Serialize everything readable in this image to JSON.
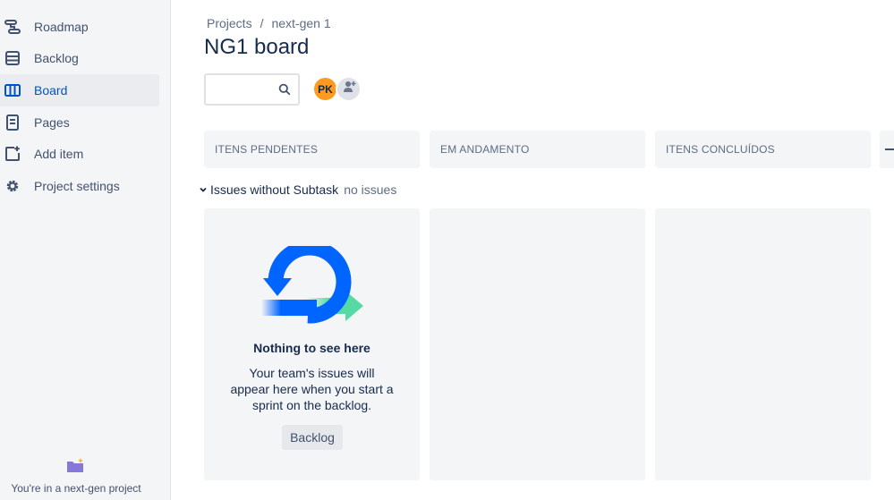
{
  "sidebar": {
    "items": [
      {
        "label": "Roadmap",
        "icon": "roadmap-icon",
        "active": false
      },
      {
        "label": "Backlog",
        "icon": "backlog-icon",
        "active": false
      },
      {
        "label": "Board",
        "icon": "board-icon",
        "active": true
      },
      {
        "label": "Pages",
        "icon": "pages-icon",
        "active": false
      },
      {
        "label": "Add item",
        "icon": "add-item-icon",
        "active": false
      },
      {
        "label": "Project settings",
        "icon": "gear-icon",
        "active": false
      }
    ],
    "footer_text": "You're in a next-gen project"
  },
  "breadcrumb": {
    "items": [
      "Projects",
      "next-gen 1"
    ],
    "separator": "/"
  },
  "page_title": "NG1 board",
  "search": {
    "placeholder": "",
    "value": ""
  },
  "avatar": {
    "initials": "PK",
    "color": "#ff991f"
  },
  "columns": [
    {
      "title": "ITENS PENDENTES"
    },
    {
      "title": "EM ANDAMENTO"
    },
    {
      "title": "ITENS CONCLUÍDOS"
    }
  ],
  "swimlane": {
    "title": "Issues without Subtask",
    "meta": "no issues"
  },
  "empty_state": {
    "title": "Nothing to see here",
    "description": "Your team's issues will appear here when you start a sprint on the backlog.",
    "button_label": "Backlog"
  },
  "colors": {
    "accent": "#0052cc",
    "sidebar_bg": "#f4f5f7",
    "column_bg": "#f4f5f7",
    "avatar_bg": "#ff991f",
    "art_blue": "#0065ff",
    "art_green": "#57d9a3"
  }
}
